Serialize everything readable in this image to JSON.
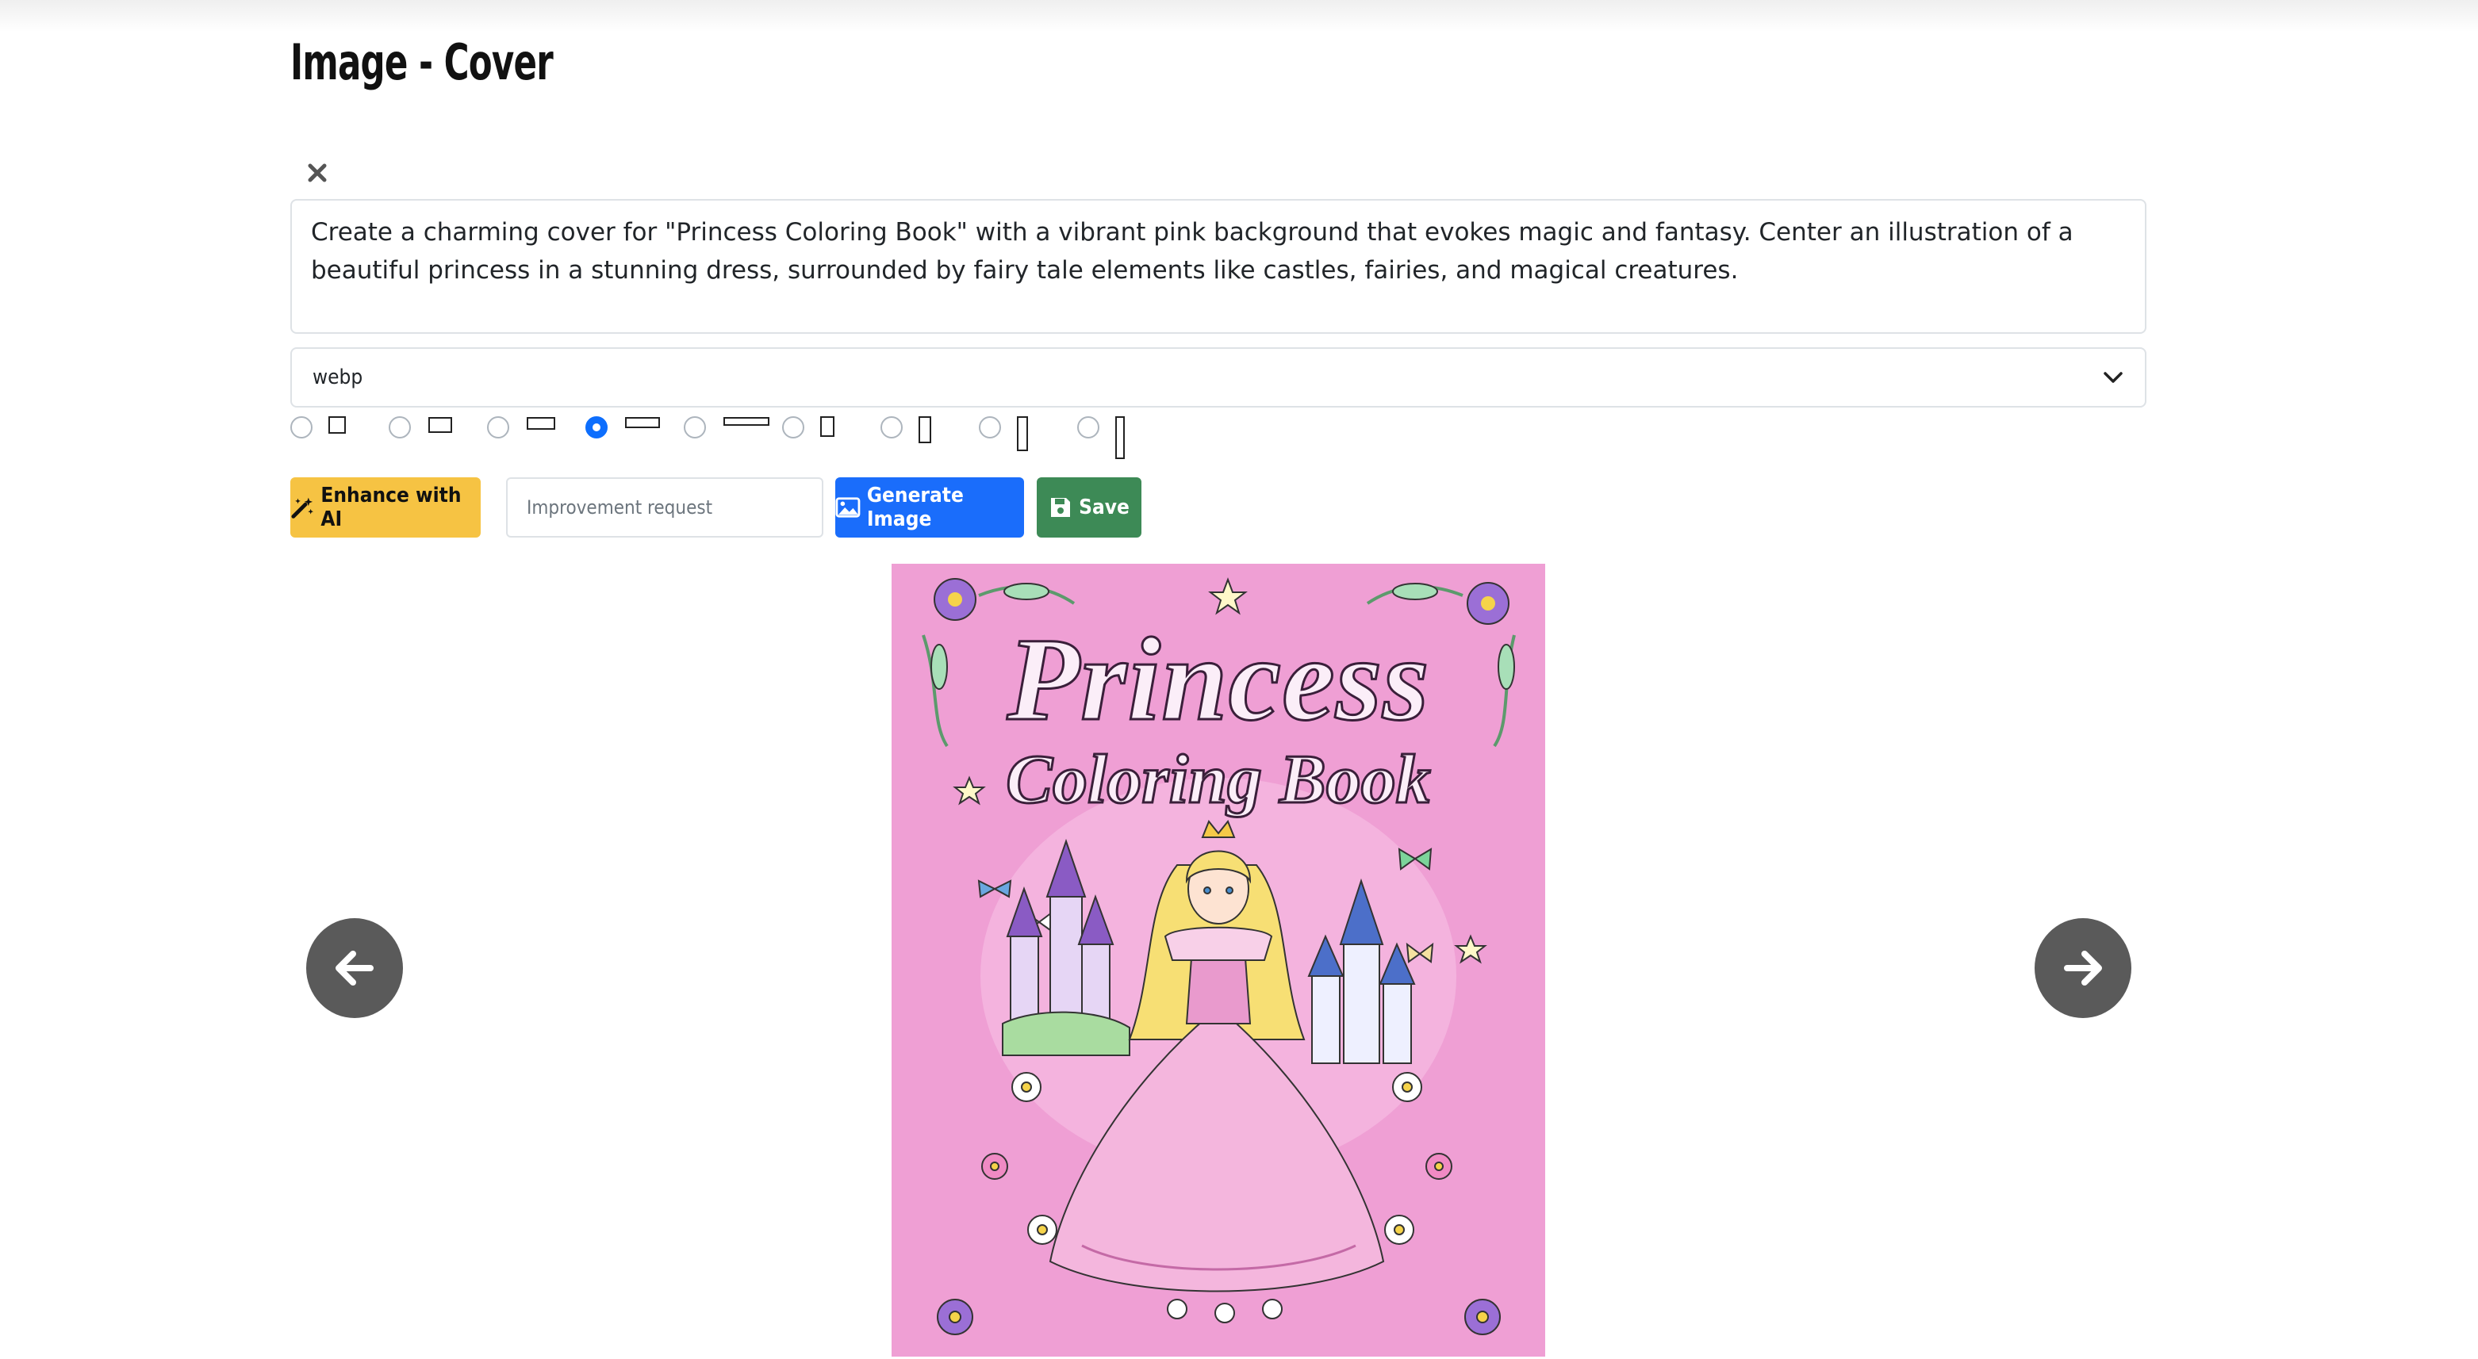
{
  "page": {
    "title": "Image - Cover"
  },
  "prompt": {
    "value": "Create a charming cover for \"Princess Coloring Book\" with a vibrant pink background that evokes magic and fantasy. Center an illustration of a beautiful princess in a stunning dress, surrounded by fairy tale elements like castles, fairies, and magical creatures."
  },
  "format_select": {
    "value": "webp"
  },
  "aspect_ratios": {
    "selected_index": 3,
    "count": 9
  },
  "actions": {
    "enhance_label": "Enhance with AI",
    "improvement_placeholder": "Improvement request",
    "generate_label": "Generate Image",
    "save_label": "Save"
  },
  "icons": {
    "close": "close-icon",
    "chevron": "chevron-down-icon",
    "wand": "magic-wand-icon",
    "image": "image-icon",
    "floppy": "floppy-disk-icon",
    "prev": "arrow-left-icon",
    "next": "arrow-right-icon"
  },
  "colors": {
    "enhance": "#f6c343",
    "generate": "#1a6dfb",
    "save": "#3d8a56",
    "radio_selected": "#0d6efd",
    "nav": "#5a5a5a",
    "cover_bg": "#ef9fd4"
  },
  "cover_image": {
    "title": "Princess",
    "subtitle": "Coloring Book"
  }
}
